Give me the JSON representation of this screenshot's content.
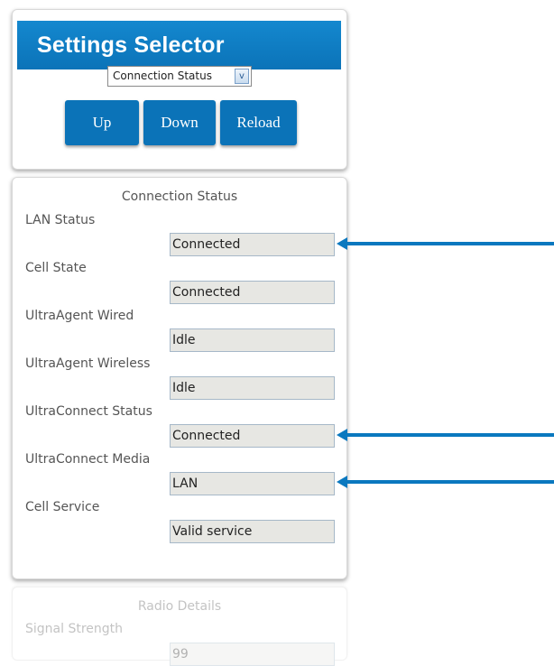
{
  "selector": {
    "title": "Settings Selector",
    "selected_option": "Connection Status",
    "dropdown_arrow": "v",
    "buttons": {
      "up": "Up",
      "down": "Down",
      "reload": "Reload"
    }
  },
  "connection_status": {
    "title": "Connection Status",
    "fields": [
      {
        "label": "LAN Status",
        "value": "Connected"
      },
      {
        "label": "Cell State",
        "value": "Connected"
      },
      {
        "label": "UltraAgent Wired",
        "value": "Idle"
      },
      {
        "label": "UltraAgent Wireless",
        "value": "Idle"
      },
      {
        "label": "UltraConnect Status",
        "value": "Connected"
      },
      {
        "label": "UltraConnect Media",
        "value": "LAN"
      },
      {
        "label": "Cell Service",
        "value": "Valid service"
      }
    ]
  },
  "radio_details": {
    "title": "Radio Details",
    "fields": [
      {
        "label": "Signal Strength",
        "value": "99"
      }
    ]
  },
  "colors": {
    "accent": "#0b73b8",
    "annotation_arrow": "#0a78bf",
    "field_background": "#e7e7e3"
  }
}
